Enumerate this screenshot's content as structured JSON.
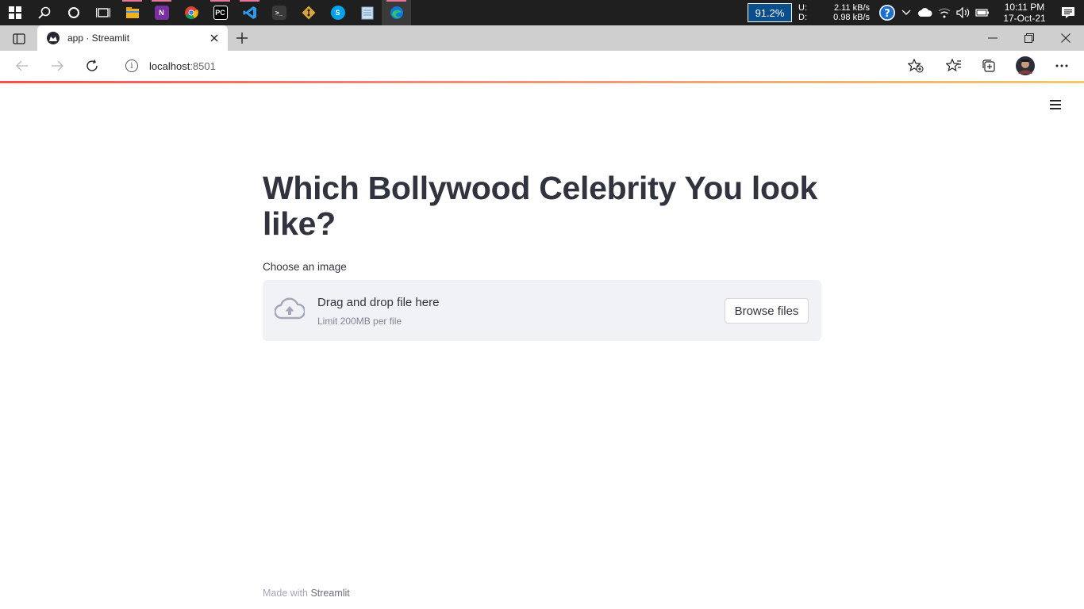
{
  "taskbar": {
    "apps": [
      {
        "name": "file-explorer",
        "color": "#f2b01e",
        "letter": ""
      },
      {
        "name": "onenote",
        "color": "#7a2fa3",
        "letter": "N"
      },
      {
        "name": "chrome",
        "color": "#1da462",
        "letter": ""
      },
      {
        "name": "pycharm",
        "color": "#000000",
        "letter": "PC"
      },
      {
        "name": "vscode",
        "color": "#1e88e5",
        "letter": ""
      },
      {
        "name": "terminal",
        "color": "#444444",
        "letter": ">_"
      },
      {
        "name": "git",
        "color": "#555555",
        "letter": ""
      },
      {
        "name": "skype",
        "color": "#00a2ed",
        "letter": "S"
      },
      {
        "name": "notepad",
        "color": "#8ab4d8",
        "letter": ""
      },
      {
        "name": "edge",
        "color": "#0f7bd8",
        "letter": ""
      }
    ],
    "battery": "91.2%",
    "upload_label": "U:",
    "download_label": "D:",
    "upload_speed": "2.11 kB/s",
    "download_speed": "0.98 kB/s",
    "time": "10:11 PM",
    "date": "17-Oct-21"
  },
  "browser": {
    "tab_title": "app · Streamlit",
    "url_host": "localhost",
    "url_port": ":8501"
  },
  "page": {
    "title": "Which Bollywood Celebrity You look like?",
    "uploader_label": "Choose an image",
    "drop_text": "Drag and drop file here",
    "limit_text": "Limit 200MB per file",
    "browse_label": "Browse files",
    "footer_prefix": "Made with ",
    "footer_link": "Streamlit"
  }
}
